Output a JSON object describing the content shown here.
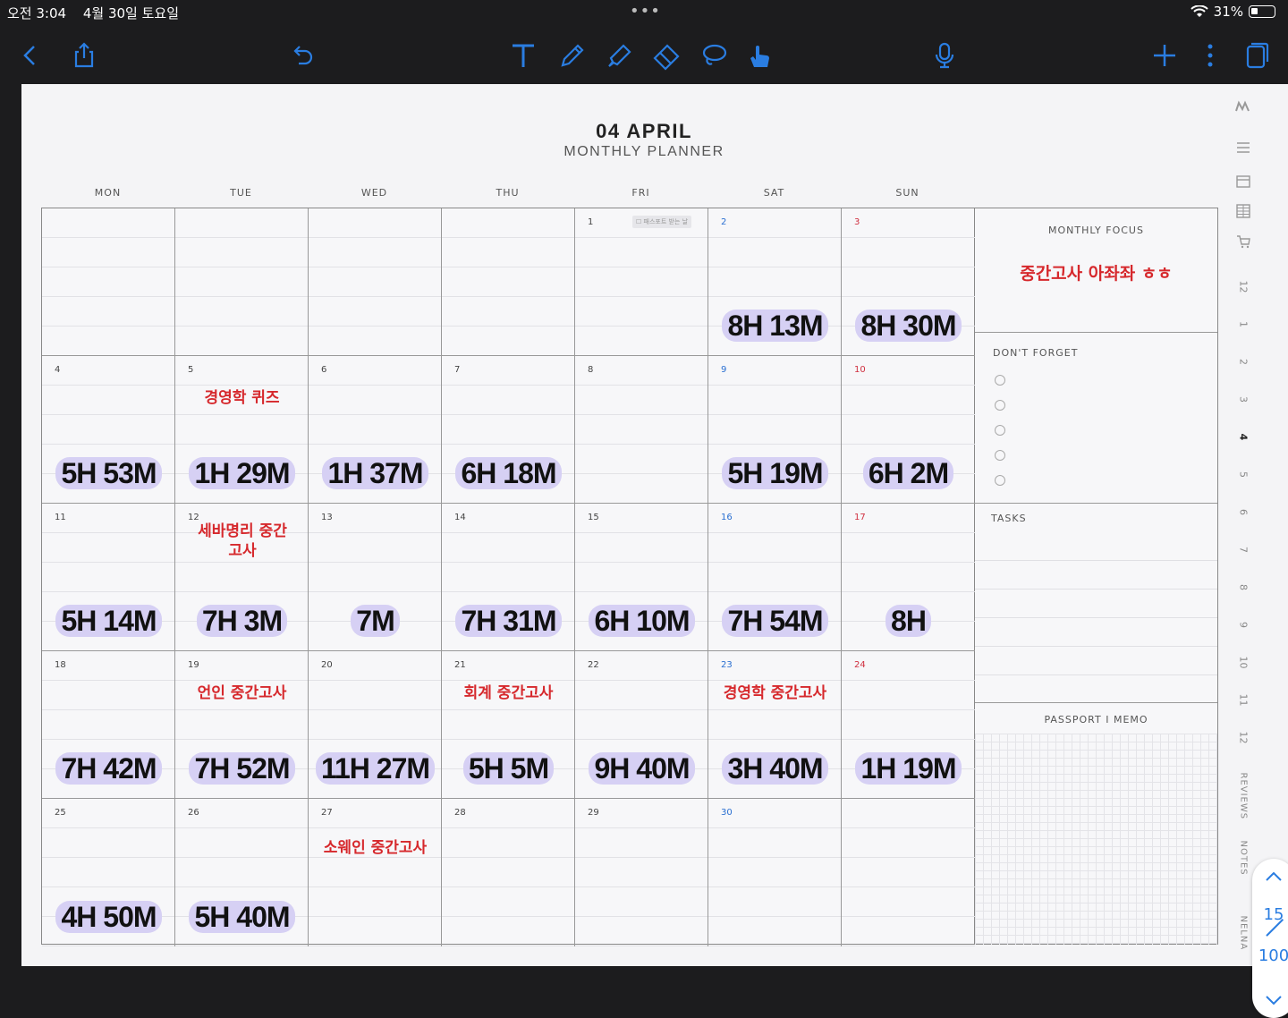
{
  "status": {
    "time": "오전 3:04",
    "date": "4월 30일 토요일",
    "battery": "31%"
  },
  "toolbar": {
    "icons": [
      "back-icon",
      "share-icon",
      "undo-icon",
      "text-tool-icon",
      "pen-icon",
      "highlighter-icon",
      "eraser-icon",
      "lasso-icon",
      "touch-hand-icon",
      "microphone-icon",
      "add-icon",
      "more-icon",
      "pages-icon"
    ]
  },
  "planner": {
    "title": "04 APRIL",
    "subtitle": "MONTHLY PLANNER",
    "days": [
      "MON",
      "TUE",
      "WED",
      "THU",
      "FRI",
      "SAT",
      "SUN"
    ],
    "fri_chip": "☐ 패스포트 받는 날",
    "weeks": [
      [
        {
          "num": "",
          "time": "",
          "note": ""
        },
        {
          "num": "",
          "time": "",
          "note": ""
        },
        {
          "num": "",
          "time": "",
          "note": ""
        },
        {
          "num": "",
          "time": "",
          "note": ""
        },
        {
          "num": "1",
          "time": "",
          "note": ""
        },
        {
          "num": "2",
          "time": "8H 13M",
          "note": ""
        },
        {
          "num": "3",
          "time": "8H 30M",
          "note": ""
        }
      ],
      [
        {
          "num": "4",
          "time": "5H 53M",
          "note": ""
        },
        {
          "num": "5",
          "time": "1H 29M",
          "note": "경영학 퀴즈"
        },
        {
          "num": "6",
          "time": "1H 37M",
          "note": ""
        },
        {
          "num": "7",
          "time": "6H 18M",
          "note": ""
        },
        {
          "num": "8",
          "time": "",
          "note": ""
        },
        {
          "num": "9",
          "time": "5H 19M",
          "note": ""
        },
        {
          "num": "10",
          "time": "6H 2M",
          "note": ""
        }
      ],
      [
        {
          "num": "11",
          "time": "5H 14M",
          "note": ""
        },
        {
          "num": "12",
          "time": "7H 3M",
          "note": "세바명리 중간고사"
        },
        {
          "num": "13",
          "time": "7M",
          "note": ""
        },
        {
          "num": "14",
          "time": "7H 31M",
          "note": ""
        },
        {
          "num": "15",
          "time": "6H 10M",
          "note": ""
        },
        {
          "num": "16",
          "time": "7H 54M",
          "note": ""
        },
        {
          "num": "17",
          "time": "8H",
          "note": ""
        }
      ],
      [
        {
          "num": "18",
          "time": "7H 42M",
          "note": ""
        },
        {
          "num": "19",
          "time": "7H 52M",
          "note": "언인 중간고사"
        },
        {
          "num": "20",
          "time": "11H 27M",
          "note": ""
        },
        {
          "num": "21",
          "time": "5H 5M",
          "note": "회계 중간고사"
        },
        {
          "num": "22",
          "time": "9H 40M",
          "note": ""
        },
        {
          "num": "23",
          "time": "3H 40M",
          "note": "경영학 중간고사"
        },
        {
          "num": "24",
          "time": "1H 19M",
          "note": ""
        }
      ],
      [
        {
          "num": "25",
          "time": "4H 50M",
          "note": ""
        },
        {
          "num": "26",
          "time": "5H 40M",
          "note": ""
        },
        {
          "num": "27",
          "time": "",
          "note": "소웨인 중간고사"
        },
        {
          "num": "28",
          "time": "",
          "note": ""
        },
        {
          "num": "29",
          "time": "",
          "note": ""
        },
        {
          "num": "30",
          "time": "",
          "note": ""
        },
        {
          "num": "",
          "time": "",
          "note": ""
        }
      ]
    ]
  },
  "side": {
    "focus_label": "MONTHLY FOCUS",
    "focus_text": "중간고사 아좌좌 ㅎㅎ",
    "dontforget_label": "DON'T FORGET",
    "tasks_label": "TASKS",
    "memo_label": "PASSPORT  I  MEMO"
  },
  "tabs": [
    "12",
    "1",
    "2",
    "3",
    "4",
    "5",
    "6",
    "7",
    "8",
    "9",
    "10",
    "11",
    "12"
  ],
  "tabs_active": "4",
  "tabs_words": [
    "REVIEWS",
    "NOTES",
    "NELNA"
  ],
  "pager": {
    "current": "15",
    "total": "100"
  }
}
